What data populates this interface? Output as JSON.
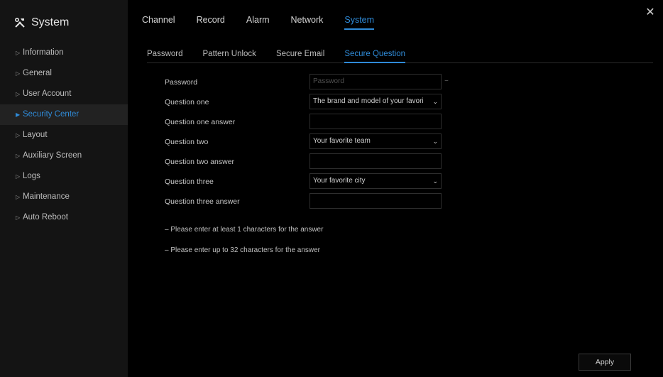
{
  "app": {
    "title": "System",
    "icon": "tools-icon"
  },
  "sidebar": {
    "items": [
      {
        "label": "Information"
      },
      {
        "label": "General"
      },
      {
        "label": "User Account"
      },
      {
        "label": "Security Center",
        "active": true
      },
      {
        "label": "Layout"
      },
      {
        "label": "Auxiliary Screen"
      },
      {
        "label": "Logs"
      },
      {
        "label": "Maintenance"
      },
      {
        "label": "Auto Reboot"
      }
    ]
  },
  "topnav": {
    "tabs": [
      "Channel",
      "Record",
      "Alarm",
      "Network",
      "System"
    ],
    "active": "System"
  },
  "subnav": {
    "tabs": [
      "Password",
      "Pattern Unlock",
      "Secure Email",
      "Secure Question"
    ],
    "active": "Secure Question"
  },
  "form": {
    "password": {
      "label": "Password",
      "placeholder": "Password",
      "value": ""
    },
    "q1": {
      "label": "Question one",
      "value": "The brand and model of your favori"
    },
    "q1_answer": {
      "label": "Question one answer",
      "value": ""
    },
    "q2": {
      "label": "Question two",
      "value": "Your favorite team"
    },
    "q2_answer": {
      "label": "Question two answer",
      "value": ""
    },
    "q3": {
      "label": "Question three",
      "value": "Your favorite city"
    },
    "q3_answer": {
      "label": "Question three answer",
      "value": ""
    }
  },
  "hints": [
    "– Please enter at least 1 characters for the answer",
    "– Please enter up to 32 characters for the answer"
  ],
  "buttons": {
    "apply": "Apply"
  },
  "colors": {
    "accent": "#2f8bd8",
    "background": "#000000",
    "sidebar": "#141414"
  }
}
